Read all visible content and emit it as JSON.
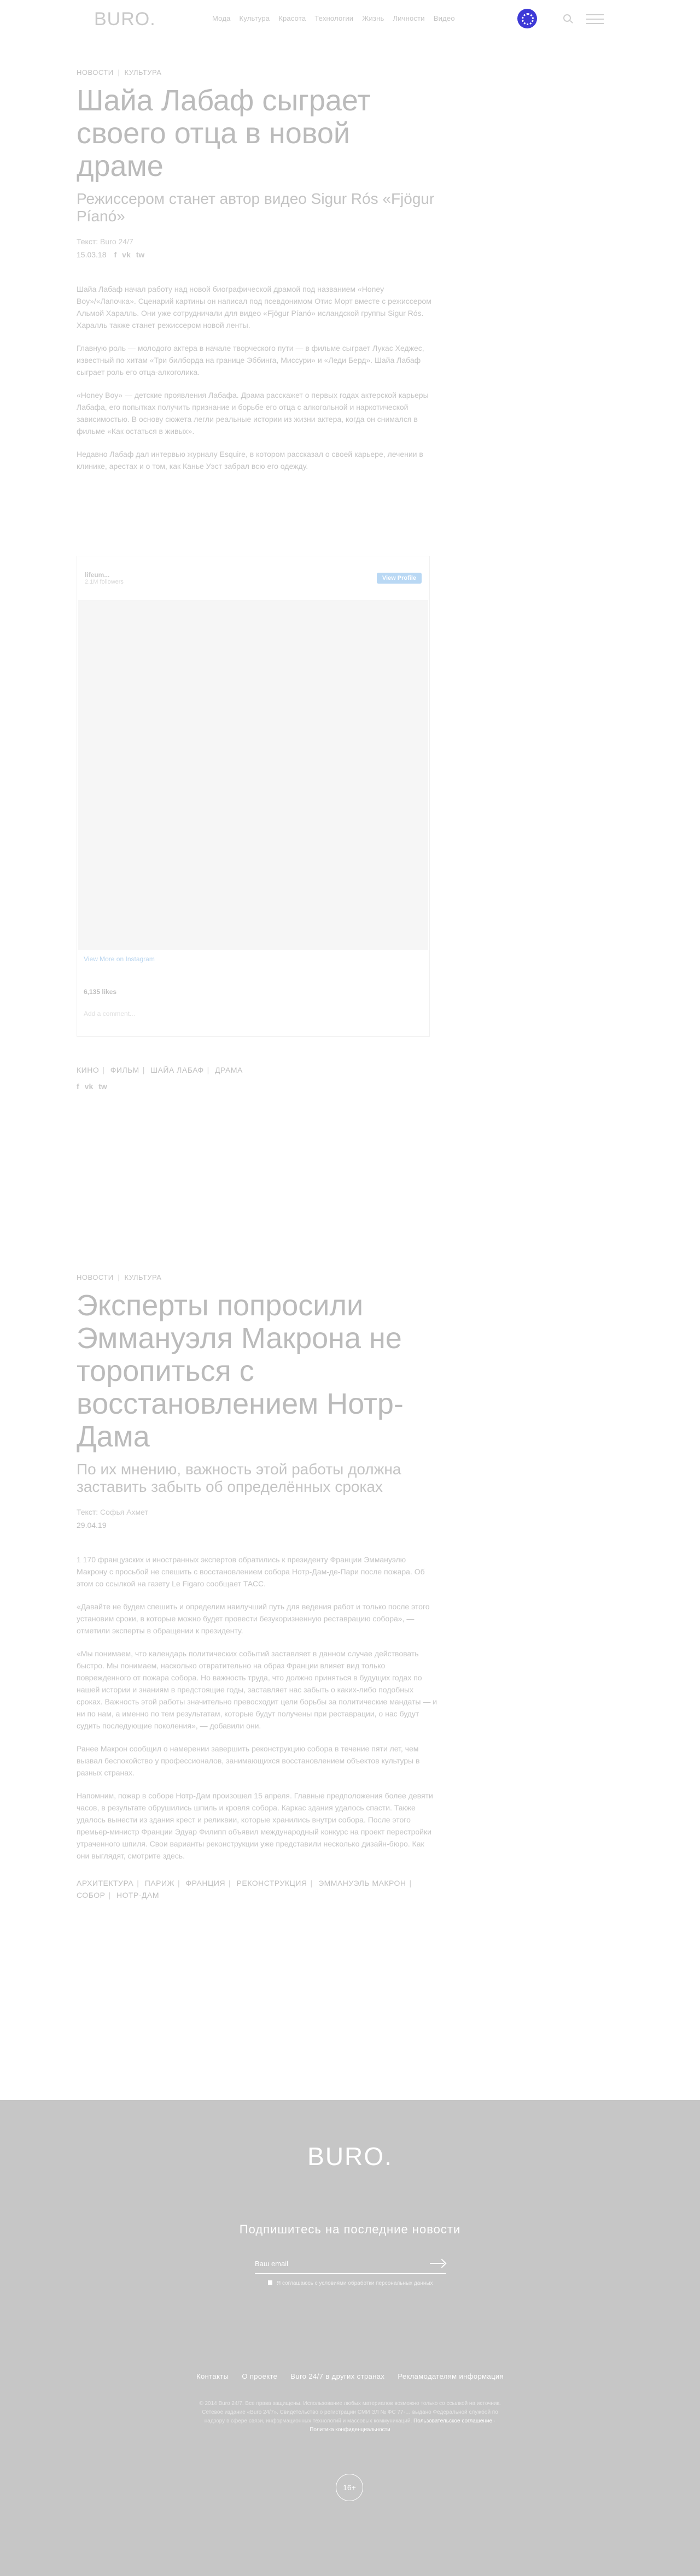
{
  "header": {
    "logo": "BURO.",
    "nav": [
      "Мода",
      "Культура",
      "Красота",
      "Технологии",
      "Жизнь",
      "Личности",
      "Видео"
    ]
  },
  "article1": {
    "crumbs": [
      "НОВОСТИ",
      "КУЛЬТУРА"
    ],
    "title": "Шайа Лабаф сыграет своего отца в новой драме",
    "subtitle": "Режиссером станет автор видео Sigur Rós «Fjögur Píanó»",
    "meta_label": "Текст: ",
    "author": "Buro 24/7",
    "date": "15.03.18",
    "share": [
      "f",
      "vk",
      "tw"
    ],
    "paragraphs": [
      "Шайа Лабаф начал работу над новой биографической драмой под названием «Honey Boy»/«Лапочка». Сценарий картины он написал под псевдонимом Отис Морт вместе с режиссером Альмой Харалль. Они уже сотрудничали для видео «Fjögur Píanó» исландской группы Sigur Rós. Харалль также станет режиссером новой ленты.",
      "Главную роль — молодого актера в начале творческого пути — в фильме сыграет Лукас Хеджес, известный по хитам «Три билборда на границе Эббинга, Миссури» и «Леди Берд». Шайа Лабаф сыграет роль его отца-алкоголика.",
      "«Honey Boy» — детские проявления Лабафа. Драма расскажет о первых годах актерской карьеры Лабафа, его попытках получить признание и борьбе его отца с алкогольной и наркотической зависимостью. В основу сюжета легли реальные истории из жизни актера, когда он снимался в фильме «Как остаться в живых».",
      "Недавно Лабаф дал интервью журналу Esquire, в котором рассказал о своей карьере, лечении в клинике, арестах и о том, как Канье Уэст забрал всю его одежду."
    ],
    "tags": [
      "КИНО",
      "ФИЛЬМ",
      "ШАЙА ЛАБАФ",
      "ДРАМА"
    ]
  },
  "embed": {
    "user": "lifeum...",
    "sub": "2.1M followers",
    "button": "View Profile",
    "view_more": "View More on Instagram",
    "likes": "6,135 likes",
    "comment": "Add a comment..."
  },
  "article2": {
    "crumbs": [
      "НОВОСТИ",
      "КУЛЬТУРА"
    ],
    "title": "Эксперты попросили Эммануэля Макрона не торопиться с восстановлением Нотр-Дама",
    "subtitle": "По их мнению, важность этой работы должна заставить забыть об определённых сроках",
    "meta_label": "Текст: ",
    "author": "Софья Ахмет",
    "date": "29.04.19",
    "paragraphs": [
      "1 170 французских и иностранных экспертов обратились к президенту Франции Эммануэлю Макрону с просьбой не спешить с восстановлением собора Нотр-Дам-де-Пари после пожара. Об этом со ссылкой на газету Le Figaro сообщает ТАСС.",
      "«Давайте не будем спешить и определим наилучший путь для ведения работ и только после этого установим сроки, в которые можно будет провести безукоризненную реставрацию собора», — отметили эксперты в обращении к президенту.",
      "«Мы понимаем, что календарь политических событий заставляет в данном случае действовать быстро. Мы понимаем, насколько отвратительно на образ Франции влияет вид только поврежденного от пожара собора. Но важность труда, что должно приняться в будущих годах по нашей истории и знаниям в предстоящие годы, заставляет нас забыть о каких-либо подобных сроках. Важность этой работы значительно превосходит цели борьбы за политические мандаты — и ни по нам, а именно по тем результатам, которые будут получены при реставрации, о нас будут судить последующие поколения», — добавили они.",
      "Ранее Макрон сообщил о намерении завершить реконструкцию собора в течение пяти лет, чем вызвал беспокойство у профессионалов, занимающихся восстановлением объектов культуры в разных странах.",
      "Напомним, пожар в соборе Нотр-Дам произошел 15 апреля. Главные предположения более девяти часов, в результате обрушились шпиль и кровля собора. Каркас здания удалось спасти. Также удалось вынести из здания крест и реликвии, которые хранились внутри собора. После этого премьер-министр Франции Эдуар Филипп объявил международный конкурс на проект перестройки утраченного шпиля. Свои варианты реконструкции уже представили несколько дизайн-бюро. Как они выглядят, смотрите здесь."
    ],
    "tags": [
      "АРХИТЕКТУРА",
      "ПАРИЖ",
      "ФРАНЦИЯ",
      "РЕКОНСТРУКЦИЯ",
      "ЭММАНУЭЛЬ МАКРОН",
      "СОБОР",
      "НОТР-ДАМ"
    ]
  },
  "footer": {
    "logo": "BURO.",
    "subscribe": "Подпишитесь на последние новости",
    "email_placeholder": "Ваш email",
    "agree": "Я соглашаюсь с условиями обработки персональных данных",
    "links": [
      "Контакты",
      "О проекте",
      "Buro 24/7 в других странах",
      "Рекламодателям информация"
    ],
    "legal": "© 2014 Buro 24/7. Все права защищены. Использование любых материалов возможно только со ссылкой на источник. Сетевое издание «Buro 24/7». Свидетельство о регистрации СМИ ЭЛ № ФС 77-… выдано Федеральной службой по надзору в сфере связи, информационных технологий и массовых коммуникаций.",
    "legal_links": "Пользовательское соглашение · Политика конфиденциальности",
    "age": "16+"
  },
  "colors": {
    "accent": "#3e3ad6",
    "footer_bg": "#c6c6c6",
    "text": "#bdbdbd"
  }
}
